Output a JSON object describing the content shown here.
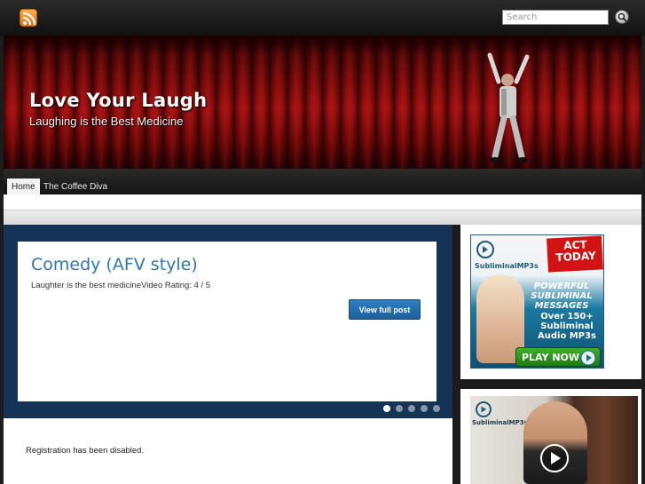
{
  "search": {
    "placeholder": "Search"
  },
  "header": {
    "title": "Love Your Laugh",
    "tagline": "Laughing is the Best Medicine"
  },
  "nav": {
    "items": [
      {
        "label": "Home",
        "active": true
      },
      {
        "label": "The Coffee Diva",
        "active": false
      }
    ]
  },
  "featured": {
    "title": "Comedy (AFV style)",
    "excerpt": "Laughter is the best medicineVideo Rating: 4 / 5",
    "button_label": "View full post",
    "slide_count": 5,
    "active_slide": 1
  },
  "notice": "Registration has been disabled.",
  "ads": {
    "ad1": {
      "brand": "SubliminalMP3s",
      "badge": "ACT TODAY",
      "headline": [
        "POWERFUL",
        "SUBLIMINAL",
        "MESSAGES"
      ],
      "subline": [
        "Over 150+",
        "Subliminal",
        "Audio MP3s"
      ],
      "cta": "PLAY NOW"
    },
    "ad2": {
      "brand": "SubliminalMP3s"
    }
  },
  "colors": {
    "accent": "#2a79b5",
    "slider_bg": "#153354",
    "button": "#1c5f99"
  },
  "icons": {
    "rss": "rss-icon",
    "search": "search-icon",
    "play": "play-icon"
  }
}
